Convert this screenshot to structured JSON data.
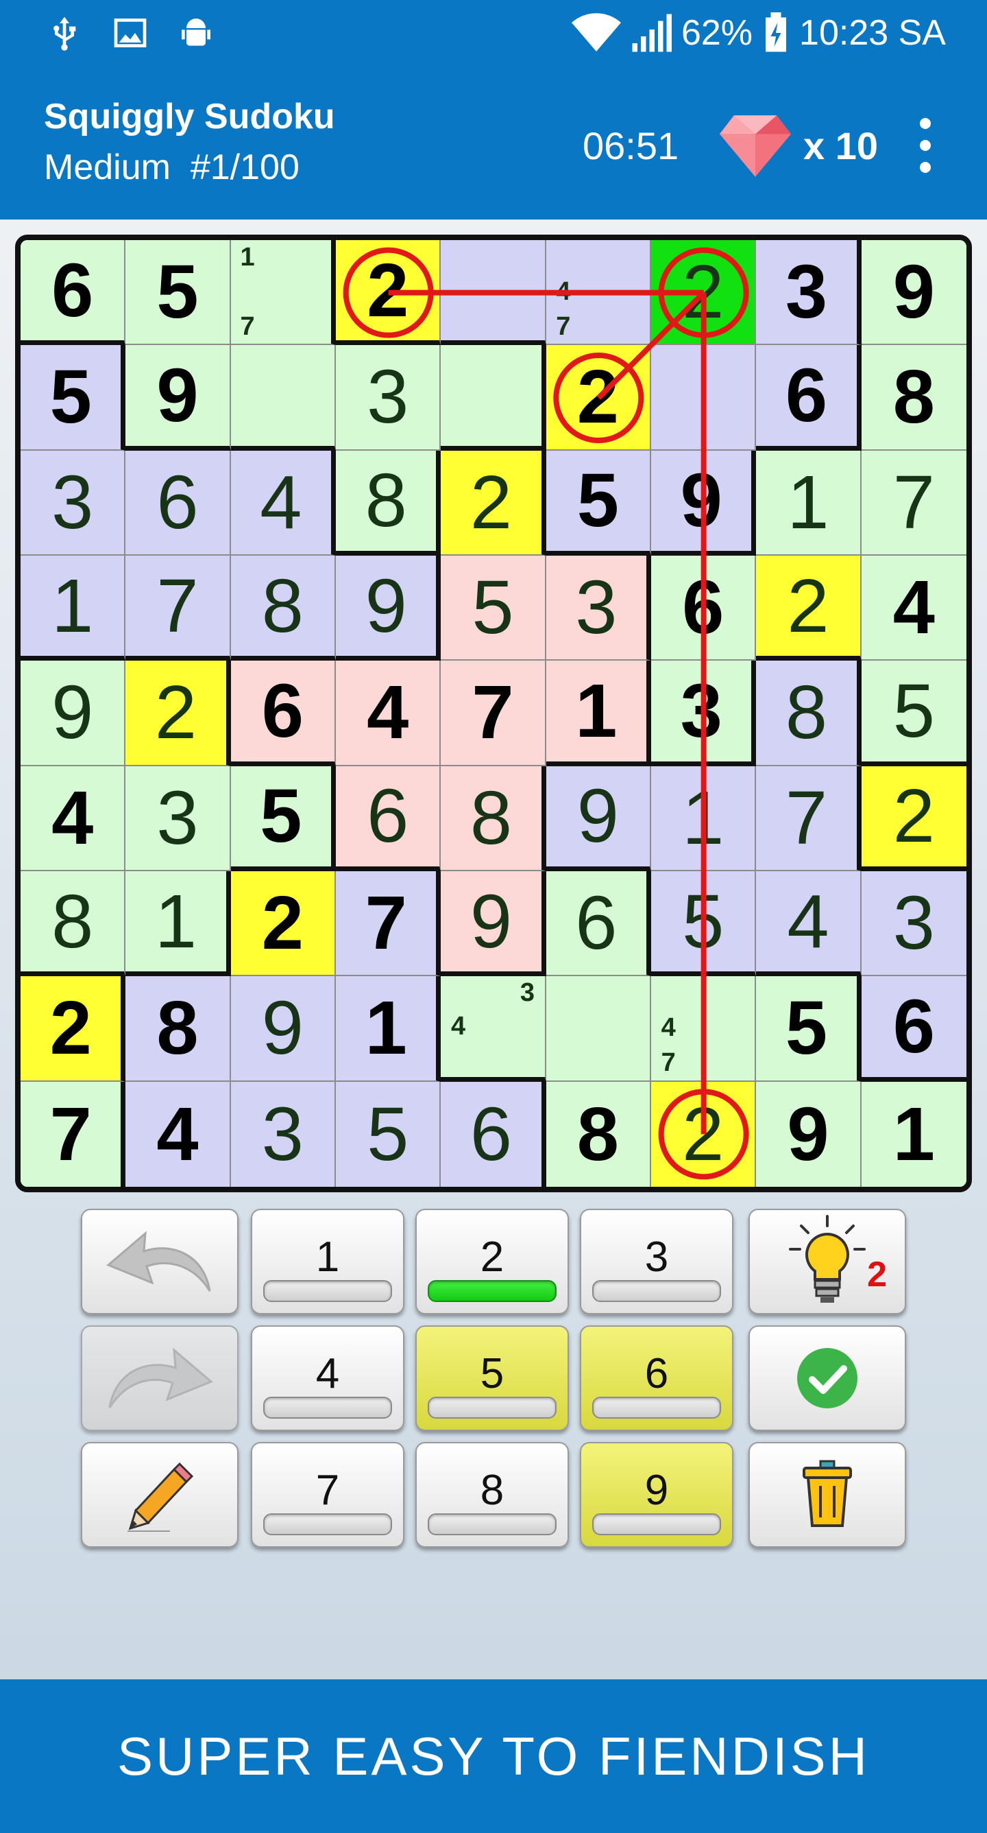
{
  "status": {
    "battery": "62%",
    "time": "10:23 SA",
    "icons": [
      "usb-icon",
      "image-icon",
      "android-icon",
      "wifi-icon",
      "signal-icon",
      "battery-charging-icon"
    ]
  },
  "app": {
    "title": "Squiggly Sudoku",
    "subtitle": "Medium  #1/100",
    "timer": "06:51",
    "gems": "x 10",
    "icons": [
      "gem-icon",
      "more-vert-icon"
    ]
  },
  "board": {
    "rows": [
      [
        "6",
        "5",
        "",
        "2",
        "",
        "",
        "2",
        "3",
        "9"
      ],
      [
        "5",
        "9",
        "",
        "3",
        "",
        "2",
        "",
        "6",
        "8"
      ],
      [
        "3",
        "6",
        "4",
        "8",
        "2",
        "5",
        "9",
        "1",
        "7"
      ],
      [
        "1",
        "7",
        "8",
        "9",
        "5",
        "3",
        "6",
        "2",
        "4"
      ],
      [
        "9",
        "2",
        "6",
        "4",
        "7",
        "1",
        "3",
        "8",
        "5"
      ],
      [
        "4",
        "3",
        "5",
        "6",
        "8",
        "9",
        "1",
        "7",
        "2"
      ],
      [
        "8",
        "1",
        "2",
        "7",
        "9",
        "6",
        "5",
        "4",
        "3"
      ],
      [
        "2",
        "8",
        "9",
        "1",
        "",
        "",
        "",
        "5",
        "6"
      ],
      [
        "7",
        "4",
        "3",
        "5",
        "6",
        "8",
        "2",
        "9",
        "1"
      ]
    ],
    "given": [
      [
        1,
        1,
        0,
        1,
        0,
        0,
        0,
        1,
        1
      ],
      [
        1,
        1,
        0,
        0,
        0,
        1,
        0,
        1,
        1
      ],
      [
        0,
        0,
        0,
        0,
        0,
        1,
        1,
        0,
        0
      ],
      [
        0,
        0,
        0,
        0,
        0,
        0,
        1,
        0,
        1
      ],
      [
        0,
        0,
        1,
        1,
        1,
        1,
        1,
        0,
        0
      ],
      [
        1,
        0,
        1,
        0,
        0,
        0,
        0,
        0,
        0
      ],
      [
        0,
        0,
        1,
        1,
        0,
        0,
        0,
        0,
        0
      ],
      [
        1,
        1,
        0,
        1,
        0,
        0,
        0,
        1,
        1
      ],
      [
        1,
        1,
        0,
        0,
        0,
        1,
        0,
        1,
        1
      ]
    ],
    "regions": [
      [
        0,
        0,
        0,
        1,
        1,
        1,
        1,
        1,
        2
      ],
      [
        3,
        0,
        0,
        0,
        0,
        1,
        1,
        1,
        2
      ],
      [
        3,
        3,
        3,
        0,
        4,
        1,
        1,
        2,
        2
      ],
      [
        3,
        3,
        3,
        3,
        4,
        4,
        2,
        2,
        2
      ],
      [
        5,
        5,
        4,
        4,
        4,
        4,
        2,
        6,
        2
      ],
      [
        5,
        5,
        5,
        4,
        4,
        6,
        6,
        6,
        7
      ],
      [
        5,
        5,
        7,
        7,
        4,
        5,
        6,
        6,
        6
      ],
      [
        8,
        7,
        7,
        7,
        5,
        5,
        5,
        5,
        6
      ],
      [
        8,
        7,
        7,
        7,
        7,
        5,
        5,
        5,
        5
      ]
    ],
    "region_colors": [
      "#d6fad4",
      "#d3d3f5",
      "#d6fad4",
      "#d3d3f5",
      "#fcd8d6",
      "#d6fad4",
      "#d3d3f5",
      "#d3d3f5",
      "#d6fad4"
    ],
    "highlight_color": "#ffff33",
    "selected_color": "#11e011",
    "highlight_cells": [
      [
        0,
        3
      ],
      [
        1,
        5
      ],
      [
        2,
        4
      ],
      [
        3,
        7
      ],
      [
        4,
        1
      ],
      [
        5,
        8
      ],
      [
        6,
        2
      ],
      [
        7,
        0
      ],
      [
        8,
        6
      ]
    ],
    "selected_cell": [
      0,
      6
    ],
    "notes": [
      {
        "cell": [
          0,
          2
        ],
        "values": [
          "1",
          "7"
        ]
      },
      {
        "cell": [
          0,
          5
        ],
        "values": [
          "4",
          "7"
        ]
      },
      {
        "cell": [
          7,
          4
        ],
        "values": [
          "4",
          "3"
        ]
      },
      {
        "cell": [
          7,
          6
        ],
        "values": [
          "4",
          "7"
        ]
      }
    ],
    "circled_cells": [
      [
        0,
        3
      ],
      [
        0,
        6
      ],
      [
        1,
        5
      ],
      [
        8,
        6
      ]
    ],
    "conflict_color": "#e01818"
  },
  "keypad": {
    "numbers": [
      "1",
      "2",
      "3",
      "4",
      "5",
      "6",
      "7",
      "8",
      "9"
    ],
    "complete_numbers": [
      "5",
      "6",
      "9"
    ],
    "active_number": "2",
    "hint_count": "2",
    "icons": [
      "undo-icon",
      "redo-icon",
      "pencil-icon",
      "lightbulb-icon",
      "check-icon",
      "trash-icon"
    ]
  },
  "footer": {
    "tagline": "SUPER EASY TO FIENDISH"
  }
}
